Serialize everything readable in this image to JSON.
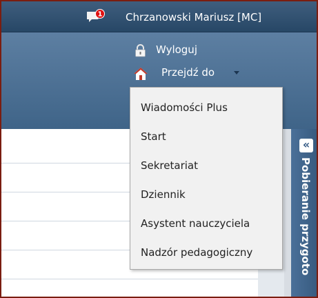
{
  "topbar": {
    "message_badge": "1",
    "user_name": "Chrzanowski Mariusz [MC]"
  },
  "header": {
    "logout_label": "Wyloguj",
    "goto_label": "Przejdź do"
  },
  "menu": {
    "items": [
      "Wiadomości Plus",
      "Start",
      "Sekretariat",
      "Dziennik",
      "Asystent nauczyciela",
      "Nadzór pedagogiczny"
    ]
  },
  "right_panel": {
    "collapse_glyph": "«",
    "title": "Pobieranie przygoto"
  },
  "colors": {
    "frame_border": "#7a1d10",
    "topbar": "#2f5070",
    "header": "#4d7296",
    "badge": "#e01010",
    "home_icon": "#c0392b"
  }
}
